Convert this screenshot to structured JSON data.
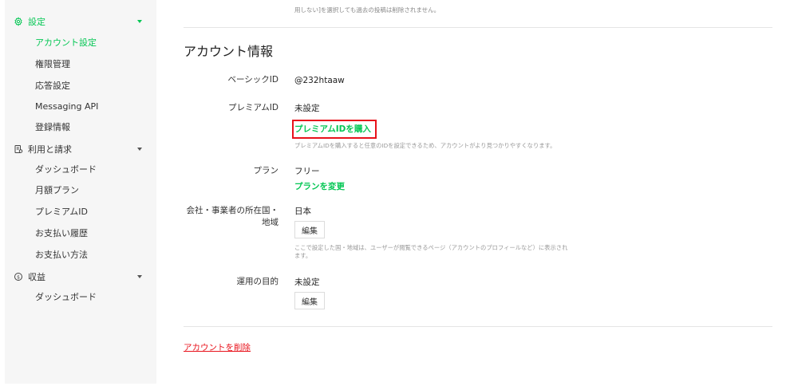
{
  "sidebar": {
    "groups": [
      {
        "label": "設定",
        "icon": "gear-icon",
        "items": [
          "アカウント設定",
          "権限管理",
          "応答設定",
          "Messaging API",
          "登録情報"
        ]
      },
      {
        "label": "利用と請求",
        "icon": "receipt-icon",
        "items": [
          "ダッシュボード",
          "月額プラン",
          "プレミアムID",
          "お支払い履歴",
          "お支払い方法"
        ]
      },
      {
        "label": "収益",
        "icon": "dollar-circle-icon",
        "items": [
          "ダッシュボード"
        ]
      }
    ],
    "active_item": "アカウント設定"
  },
  "main": {
    "top_note": "用しない]を選択しても過去の投稿は削除されません。",
    "section_title": "アカウント情報",
    "basic_id": {
      "label": "ベーシックID",
      "value": "@232htaaw"
    },
    "premium_id": {
      "label": "プレミアムID",
      "value": "未設定",
      "buy_link": "プレミアムIDを購入",
      "help": "プレミアムIDを購入すると任意のIDを設定できるため、アカウントがより見つかりやすくなります。"
    },
    "plan": {
      "label": "プラン",
      "value": "フリー",
      "change_link": "プランを変更"
    },
    "country": {
      "label_line1": "会社・事業者の所在国・",
      "label_line2": "地域",
      "value": "日本",
      "edit_label": "編集",
      "help_line1": "ここで設定した国・地域は、ユーザーが閲覧できるページ（アカウントのプロフィールなど）に表示され",
      "help_line2": "ます。"
    },
    "purpose": {
      "label": "運用の目的",
      "value": "未設定",
      "edit_label": "編集"
    },
    "delete_link": "アカウントを削除"
  },
  "colors": {
    "accent": "#06c755",
    "highlight": "#e8121b",
    "sidebar_bg": "#f6f6f6"
  }
}
